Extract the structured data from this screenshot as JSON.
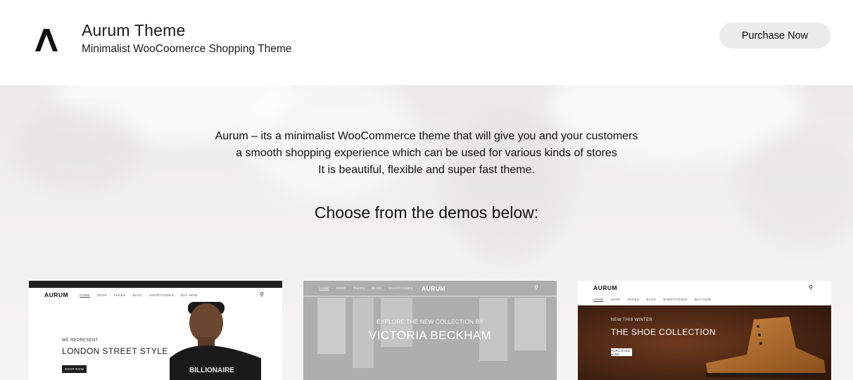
{
  "header": {
    "title": "Aurum Theme",
    "subtitle": "Minimalist WooCoomerce Shopping Theme",
    "purchase_label": "Purchase Now"
  },
  "hero": {
    "intro_lines": [
      "Aurum – its a minimalist WooCommerce theme that will give you and your customers",
      "a smooth shopping experience which can be used for various kinds of stores",
      "It is beautiful, flexible and super fast theme."
    ],
    "choose_label": "Choose from the demos below:"
  },
  "demos": [
    {
      "logo": "AURUM",
      "menu": [
        "HOME",
        "SHOP",
        "PAGES",
        "BLOG",
        "SHORTCODES",
        "BUY NOW"
      ],
      "kicker": "WE REPRESENT",
      "headline": "LONDON STREET STYLE",
      "button": "SHOP NOW"
    },
    {
      "logo": "AURUM",
      "menu": [
        "HOME",
        "SHOP",
        "PAGES",
        "BLOG",
        "SHORTCODES"
      ],
      "kicker": "EXPLORE THE NEW COLLECTION BY",
      "headline": "VICTORIA BECKHAM"
    },
    {
      "logo": "AURUM",
      "menu": [
        "HOME",
        "SHOP",
        "PAGES",
        "BLOG",
        "SHORTCODES",
        "BUY NOW"
      ],
      "kicker": "NEW THIS WINTER",
      "headline": "THE SHOE COLLECTION",
      "button": "PURCHASE NOW"
    }
  ],
  "icons": {
    "logo": "aurum-logo-icon",
    "search": "search-icon",
    "cart": "cart-icon"
  }
}
